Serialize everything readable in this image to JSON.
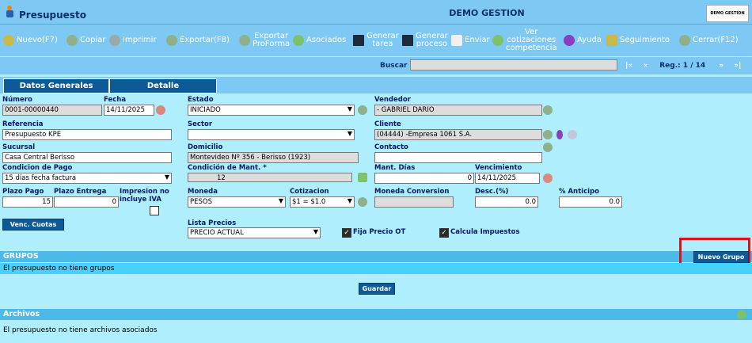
{
  "window": {
    "title": "Presupuesto",
    "company": "DEMO GESTION",
    "logo": "DEMO GESTION"
  },
  "toolbar": {
    "nuevo": "Nuevo(F7)",
    "copiar": "Copiar",
    "imprimir": "Imprimir",
    "exportar": "Exportar(F8)",
    "exportar_proforma_1": "Exportar",
    "exportar_proforma_2": "ProForma",
    "asociados": "Asociados",
    "generar_tarea_1": "Generar",
    "generar_tarea_2": "tarea",
    "generar_proceso_1": "Generar",
    "generar_proceso_2": "proceso",
    "enviar": "Enviar",
    "ver_cot_1": "Ver",
    "ver_cot_2": "cotizaciones",
    "ver_cot_3": "competencia",
    "ayuda": "Ayuda",
    "seguimiento": "Seguimiento",
    "cerrar": "Cerrar(F12)"
  },
  "search": {
    "label": "Buscar",
    "value": "",
    "nav_first": "|«",
    "nav_prev": "«",
    "reg_label": "Reg.: 1 / 14",
    "nav_next": "»",
    "nav_last": "»|"
  },
  "tabs": {
    "general": "Datos Generales",
    "detalle": "Detalle"
  },
  "form": {
    "numero_label": "Número",
    "numero": "0001-00000440",
    "fecha_label": "Fecha",
    "fecha": "14/11/2025",
    "estado_label": "Estado",
    "estado": "INICIADO",
    "vendedor_label": "Vendedor",
    "vendedor": "- GABRIEL DARIO",
    "referencia_label": "Referencia",
    "referencia": "Presupuesto KPE",
    "sector_label": "Sector",
    "sector": "",
    "cliente_label": "Cliente",
    "cliente": "(04444) -Empresa 1061 S.A.",
    "sucursal_label": "Sucursal",
    "sucursal": "Casa Central Berisso",
    "domicilio_label": "Domicilio",
    "domicilio": "Montevideo Nº 356 - Berisso (1923)",
    "contacto_label": "Contacto",
    "contacto": "",
    "condpago_label": "Condicion de Pago",
    "condpago": "15 días fecha factura",
    "condmant_label": "Condición de Mant. *",
    "condmant": "12",
    "mantdias_label": "Mant. Días",
    "mantdias": "0",
    "venc_label": "Vencimiento",
    "venc": "14/11/2025",
    "plazopago_label": "Plazo Pago",
    "plazopago": "15",
    "plazoentrega_label": "Plazo Entrega",
    "plazoentrega": "0",
    "impresion_label_1": "Impresion no",
    "impresion_label_2": "incluye IVA",
    "moneda_label": "Moneda",
    "moneda": "PESOS",
    "cotizacion_label": "Cotizacion",
    "cotizacion": "$1 = $1.0",
    "monconv_label": "Moneda Conversion",
    "monconv": "",
    "desc_label": "Desc.(%)",
    "desc": "0.0",
    "anticipo_label": "% Anticipo",
    "anticipo": "0.0",
    "venc_cuotas": "Venc. Cuotas",
    "lista_label": "Lista Precios",
    "lista": "PRECIO ACTUAL",
    "fija_label": "Fija Precio OT",
    "calcula_label": "Calcula Impuestos"
  },
  "grupos": {
    "title": "GRUPOS",
    "nuevo": "Nuevo Grupo",
    "empty": "El presupuesto no tiene grupos",
    "guardar": "Guardar"
  },
  "archivos": {
    "title": "Archivos",
    "empty": "El presupuesto no tiene archivos asociados"
  },
  "colors": {
    "header": "#7ec9f4",
    "bg": "#aeeefd",
    "button": "#0d5a99",
    "section": "#4bb9ea",
    "highlight": "#e0101a"
  }
}
